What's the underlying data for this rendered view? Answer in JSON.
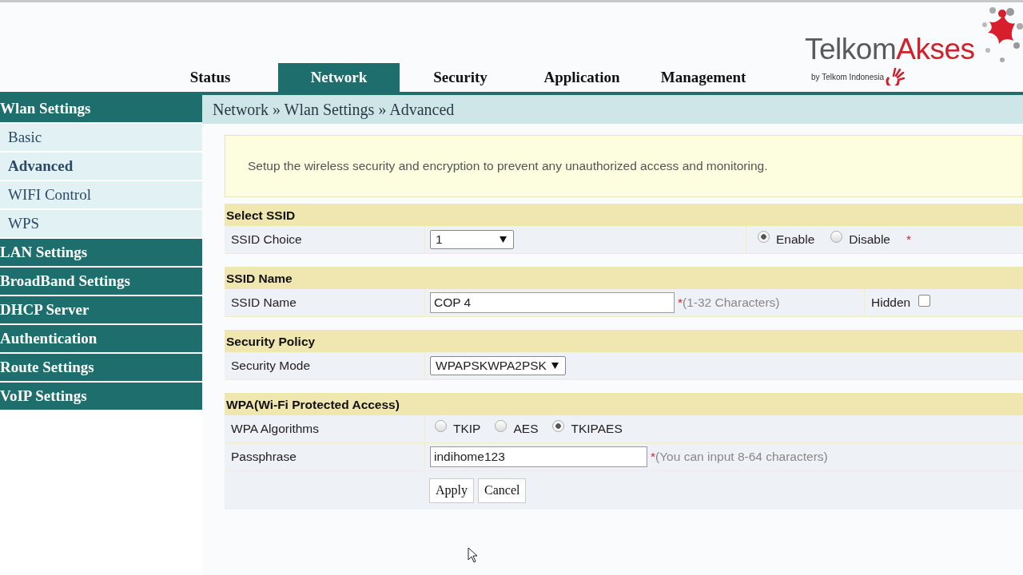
{
  "logo": {
    "brand_dark": "Telkom",
    "brand_accent": "Akses",
    "tagline": "by Telkom Indonesia"
  },
  "tabs": [
    {
      "label": "Status",
      "selected": false
    },
    {
      "label": "Network",
      "selected": true
    },
    {
      "label": "Security",
      "selected": false
    },
    {
      "label": "Application",
      "selected": false
    },
    {
      "label": "Management",
      "selected": false
    }
  ],
  "sidebar": [
    {
      "label": "Wlan Settings",
      "children": [
        {
          "label": "Basic",
          "selected": false
        },
        {
          "label": "Advanced",
          "selected": true
        },
        {
          "label": "WIFI Control",
          "selected": false
        },
        {
          "label": "WPS",
          "selected": false
        }
      ]
    },
    {
      "label": "LAN Settings"
    },
    {
      "label": "BroadBand Settings"
    },
    {
      "label": "DHCP Server"
    },
    {
      "label": "Authentication"
    },
    {
      "label": "Route Settings"
    },
    {
      "label": "VoIP Settings"
    }
  ],
  "breadcrumb": "Network » Wlan Settings » Advanced",
  "notice": "Setup the wireless security and encryption to prevent any unauthorized access and monitoring.",
  "sections": [
    {
      "title": "Select SSID",
      "rows": [
        {
          "label": "SSID Choice",
          "control": {
            "kind": "select",
            "value": "1"
          },
          "extra": {
            "kind": "radios",
            "options": [
              {
                "label": "Enable",
                "selected": true
              },
              {
                "label": "Disable",
                "selected": false
              }
            ],
            "mark": "*"
          }
        }
      ]
    },
    {
      "title": "SSID Name",
      "rows": [
        {
          "label": "SSID Name",
          "control": {
            "kind": "text",
            "value": "COP 4"
          },
          "note": {
            "mark": "*",
            "text": "(1-32 Characters)"
          },
          "extra": {
            "kind": "checkbox",
            "label": "Hidden",
            "checked": false
          }
        }
      ]
    },
    {
      "title": "Security Policy",
      "rows": [
        {
          "label": "Security Mode",
          "control": {
            "kind": "select",
            "value": "WPAPSKWPA2PSK"
          }
        }
      ]
    },
    {
      "title": "WPA(Wi-Fi Protected Access)",
      "rows": [
        {
          "label": "WPA Algorithms",
          "control": {
            "kind": "radios",
            "options": [
              {
                "label": "TKIP",
                "selected": false
              },
              {
                "label": "AES",
                "selected": false
              },
              {
                "label": "TKIPAES",
                "selected": true
              }
            ]
          }
        },
        {
          "label": "Passphrase",
          "control": {
            "kind": "text",
            "value": "indihome123"
          },
          "note": {
            "mark": "*",
            "text": "(You can input 8-64 characters)"
          }
        }
      ]
    }
  ],
  "buttons": [
    "Apply",
    "Cancel"
  ]
}
